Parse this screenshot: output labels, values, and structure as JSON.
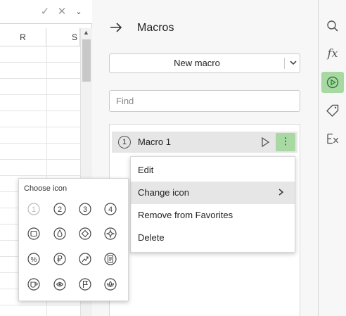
{
  "sheet": {
    "columns": [
      "R",
      "S"
    ],
    "formula_icons": [
      "check-icon",
      "cancel-icon",
      "chevron-down-icon"
    ]
  },
  "panel": {
    "title": "Macros",
    "new_macro_label": "New macro",
    "find_placeholder": "Find",
    "macros": [
      {
        "number": "1",
        "name": "Macro 1"
      }
    ]
  },
  "context_menu": {
    "items": [
      "Edit",
      "Change icon",
      "Remove from Favorites",
      "Delete"
    ],
    "highlighted": "Change icon"
  },
  "icon_picker": {
    "title": "Choose icon",
    "icons": [
      "circle-1-icon",
      "circle-2-icon",
      "circle-3-icon",
      "circle-4-icon",
      "square-icon",
      "drop-icon",
      "diamond-icon",
      "star-burst-icon",
      "percent-icon",
      "ruble-icon",
      "trend-up-icon",
      "document-icon",
      "cup-icon",
      "eye-icon",
      "flag-icon",
      "lotus-icon"
    ]
  },
  "sidebar": {
    "buttons": [
      "search-icon",
      "function-icon",
      "macros-icon",
      "tag-icon",
      "clear-formatting-icon"
    ],
    "active": "macros-icon",
    "accent": "#a9d9a3"
  }
}
